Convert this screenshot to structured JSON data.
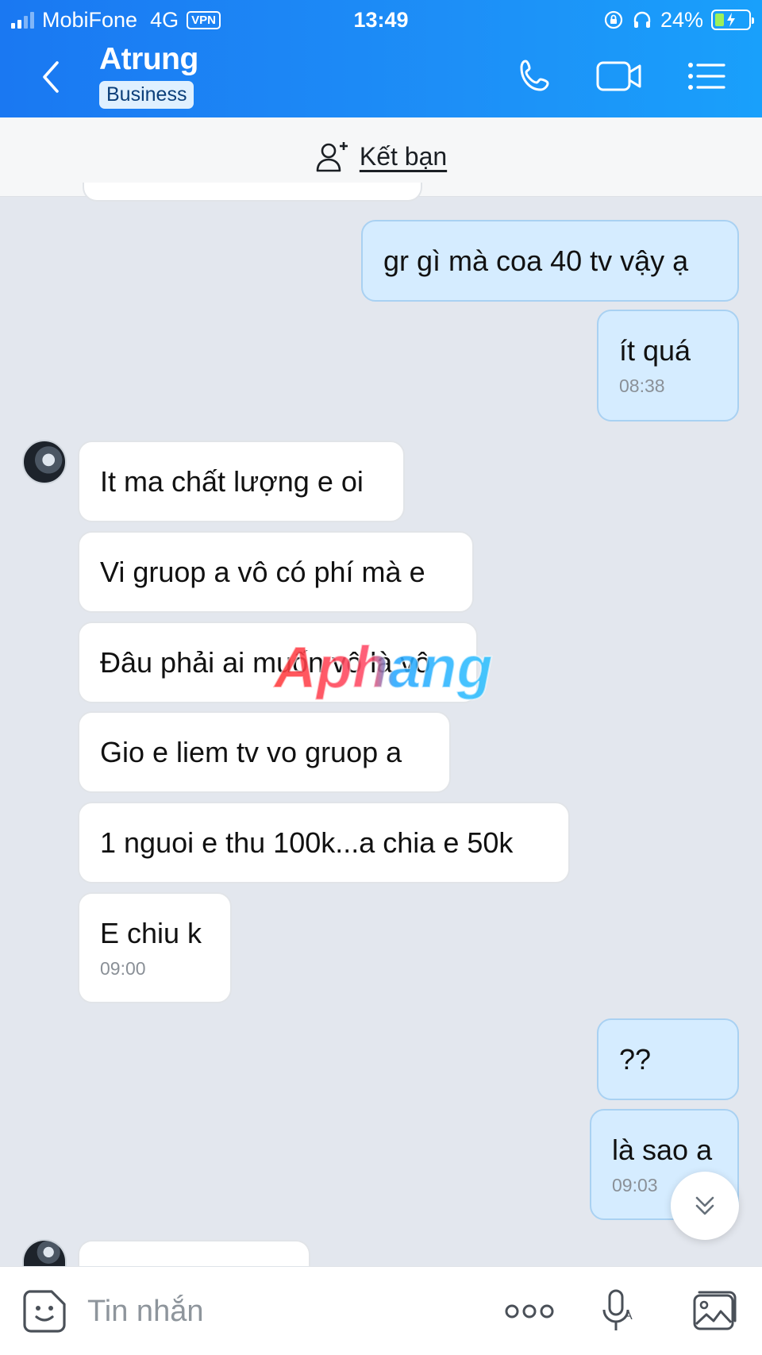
{
  "status_bar": {
    "carrier": "MobiFone",
    "network": "4G",
    "vpn": "VPN",
    "time": "13:49",
    "battery": "24%",
    "battery_level": 0.24
  },
  "header": {
    "contact_name": "Atrung",
    "badge": "Business",
    "icons": [
      "back-icon",
      "phone-icon",
      "video-call-icon",
      "menu-list-icon"
    ]
  },
  "friend_bar": {
    "label": "Kết bạn",
    "icon": "add-friend-icon"
  },
  "messages": [
    {
      "direction": "out",
      "text": "gr gì mà coa 40 tv vậy ạ"
    },
    {
      "direction": "out",
      "text": "ít quá",
      "time": "08:38"
    },
    {
      "direction": "in",
      "text": "It ma chất lượng e oi"
    },
    {
      "direction": "in",
      "text": "Vi gruop a vô có phí mà e"
    },
    {
      "direction": "in",
      "text": "Đâu phải ai muốn vô là vô"
    },
    {
      "direction": "in",
      "text": "Gio e liem tv vo gruop a"
    },
    {
      "direction": "in",
      "text": "1 nguoi e thu 100k...a chia e 50k"
    },
    {
      "direction": "in",
      "text": "E chiu k",
      "time": "09:00"
    },
    {
      "direction": "out",
      "text": "??"
    },
    {
      "direction": "out",
      "text": "là sao a",
      "time": "09:03"
    }
  ],
  "watermark": "Aphang",
  "input_bar": {
    "placeholder": "Tin nhắn",
    "icons": [
      "emoji-sticker-icon",
      "more-options-icon",
      "voice-to-text-icon",
      "image-gallery-icon"
    ]
  },
  "colors": {
    "header": "#1a78f2",
    "outgoing_bubble": "#d5ecff",
    "incoming_bubble": "#ffffff",
    "chat_background": "#e3e7ee"
  }
}
